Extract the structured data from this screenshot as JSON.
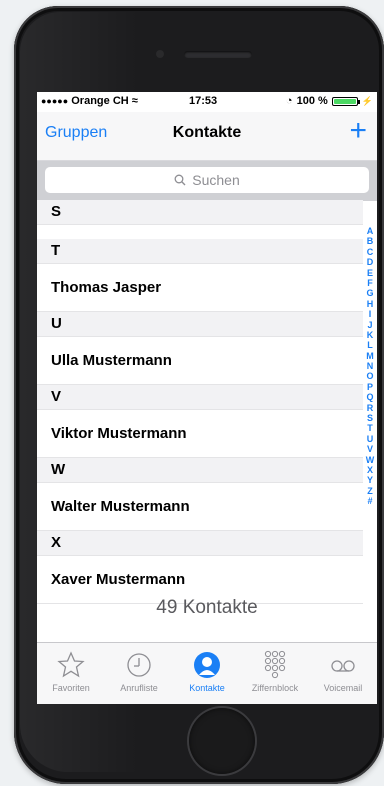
{
  "status": {
    "carrier": "Orange CH",
    "time": "17:53",
    "battery": "100 %",
    "battery_level": 1.0
  },
  "nav": {
    "back_label": "Gruppen",
    "title": "Kontakte",
    "add_label": "+"
  },
  "search": {
    "placeholder": "Suchen"
  },
  "sections": [
    {
      "letter": "S",
      "contacts": []
    },
    {
      "letter": "T",
      "contacts": [
        "Thomas Jasper"
      ]
    },
    {
      "letter": "U",
      "contacts": [
        "Ulla Mustermann"
      ]
    },
    {
      "letter": "V",
      "contacts": [
        "Viktor Mustermann"
      ]
    },
    {
      "letter": "W",
      "contacts": [
        "Walter Mustermann"
      ]
    },
    {
      "letter": "X",
      "contacts": [
        "Xaver Mustermann"
      ]
    }
  ],
  "contact_count": "49 Kontakte",
  "index": [
    "A",
    "B",
    "C",
    "D",
    "E",
    "F",
    "G",
    "H",
    "I",
    "J",
    "K",
    "L",
    "M",
    "N",
    "O",
    "P",
    "Q",
    "R",
    "S",
    "T",
    "U",
    "V",
    "W",
    "X",
    "Y",
    "Z",
    "#"
  ],
  "tabs": [
    {
      "label": "Favoriten",
      "icon": "star-icon",
      "active": false
    },
    {
      "label": "Anrufliste",
      "icon": "clock-icon",
      "active": false
    },
    {
      "label": "Kontakte",
      "icon": "contact-icon",
      "active": true
    },
    {
      "label": "Ziffernblock",
      "icon": "keypad-icon",
      "active": false
    },
    {
      "label": "Voicemail",
      "icon": "voicemail-icon",
      "active": false
    }
  ],
  "colors": {
    "accent": "#1a7ff5",
    "battery": "#4cd964"
  }
}
